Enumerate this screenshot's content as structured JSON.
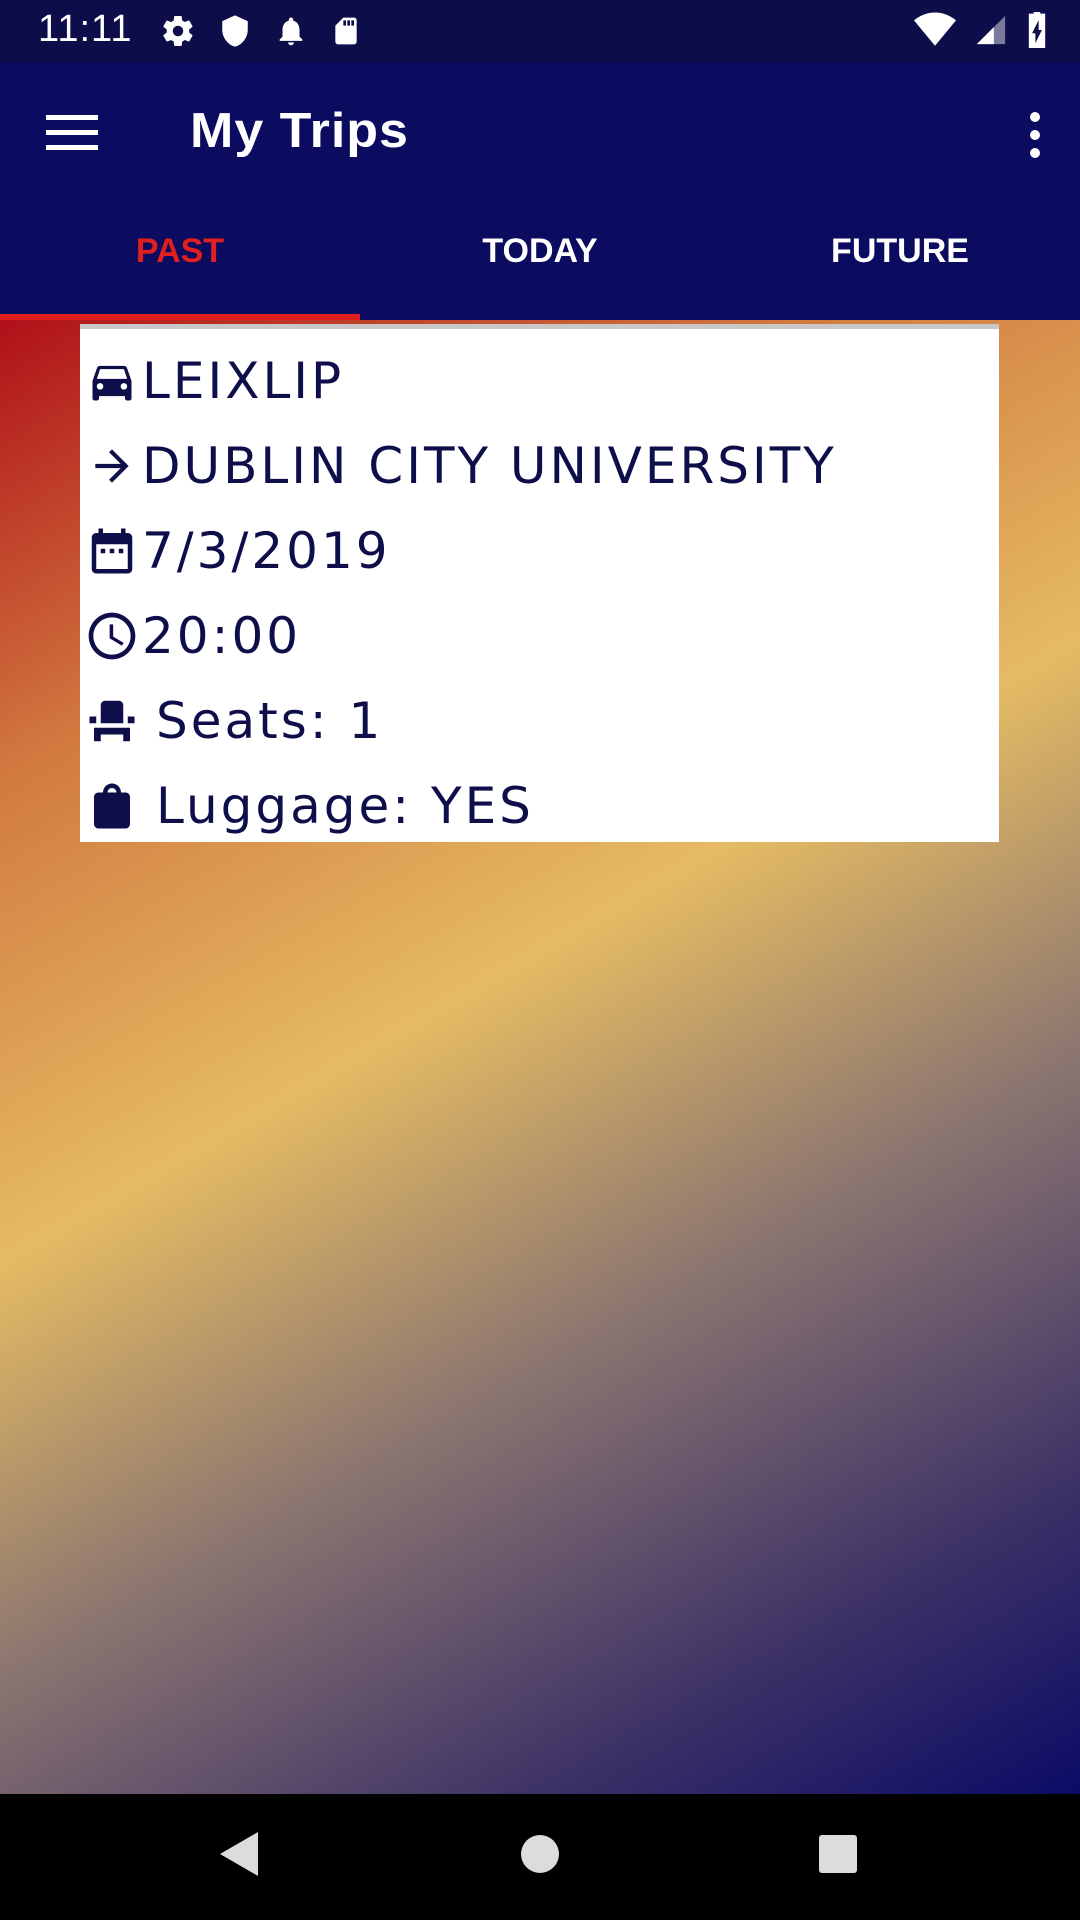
{
  "status_bar": {
    "time": "11:11",
    "icons": [
      "settings-icon",
      "shield-icon",
      "notification-bell-icon",
      "sd-card-icon",
      "wifi-icon",
      "signal-icon",
      "battery-charging-icon"
    ]
  },
  "app_bar": {
    "title": "My Trips",
    "menu_icon": "hamburger-menu-icon",
    "overflow_icon": "more-vert-icon"
  },
  "tabs": [
    {
      "label": "PAST",
      "active": true
    },
    {
      "label": "TODAY",
      "active": false
    },
    {
      "label": "FUTURE",
      "active": false
    }
  ],
  "trip": {
    "origin": "LEIXLIP",
    "destination": "DUBLIN CITY UNIVERSITY",
    "date": "7/3/2019",
    "time": "20:00",
    "seats": "Seats: 1",
    "luggage": "Luggage: YES"
  },
  "nav_bar": {
    "back": "back-triangle-icon",
    "home": "home-circle-icon",
    "recents": "recents-square-icon"
  },
  "colors": {
    "app_bar": "#0b0b5f",
    "active_tab": "#e0201f",
    "card_text": "#0e0e4a"
  }
}
